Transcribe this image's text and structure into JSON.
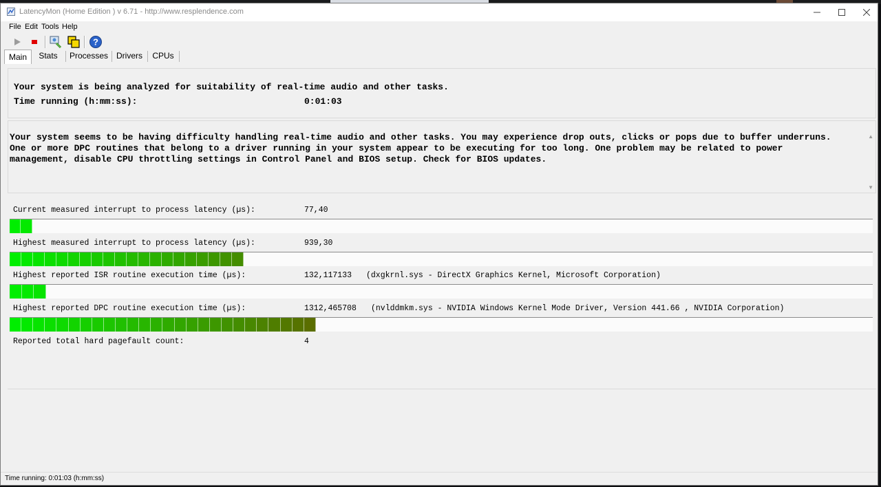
{
  "window": {
    "title": "LatencyMon  (Home Edition )  v 6.71 - http://www.resplendence.com"
  },
  "menu": [
    "File",
    "Edit",
    "Tools",
    "Help"
  ],
  "toolbar": {
    "icons": [
      "play-icon",
      "stop-icon",
      "monitor-icon",
      "windows-icon",
      "help-icon"
    ]
  },
  "tabs": [
    "Main",
    "Stats",
    "Processes",
    "Drivers",
    "CPUs"
  ],
  "active_tab": "Main",
  "header": {
    "analysis_text": "Your system is being analyzed for suitability of real-time audio and other tasks.",
    "time_label": "Time running (h:mm:ss):",
    "time_value": "0:01:03"
  },
  "message": {
    "lines": [
      "Your system seems to be having difficulty handling real-time audio and other tasks. You may experience drop outs, clicks or pops due to buffer underruns.",
      "One or more DPC routines that belong to a driver running in your system appear to be executing for too long. One problem may be related to power",
      "management, disable CPU throttling settings in Control Panel and BIOS setup. Check for BIOS updates."
    ]
  },
  "stats": [
    {
      "label": "Current measured interrupt to process latency (µs):",
      "value": "77,40",
      "detail": "",
      "bar_fraction": 0.026
    },
    {
      "label": "Highest measured interrupt to process latency (µs):",
      "value": "939,30",
      "detail": "",
      "bar_fraction": 0.271
    },
    {
      "label": "Highest reported ISR routine execution time (µs):",
      "value": "132,117133",
      "detail": "(dxgkrnl.sys - DirectX Graphics Kernel, Microsoft Corporation)",
      "bar_fraction": 0.042
    },
    {
      "label": "Highest reported DPC routine execution time (µs):",
      "value": "1312,465708",
      "detail": "(nvlddmkm.sys - NVIDIA Windows Kernel Mode Driver, Version 441.66 , NVIDIA Corporation)",
      "bar_fraction": 0.355
    },
    {
      "label": "Reported total hard pagefault count:",
      "value": "4",
      "detail": ""
    }
  ],
  "colors": {
    "bar_start": "#00ee00",
    "bar_end": "#5a6e00",
    "stop_red": "#e00000",
    "help_blue": "#2a62c9"
  },
  "statusbar": {
    "text": "Time running: 0:01:03  (h:mm:ss)"
  }
}
